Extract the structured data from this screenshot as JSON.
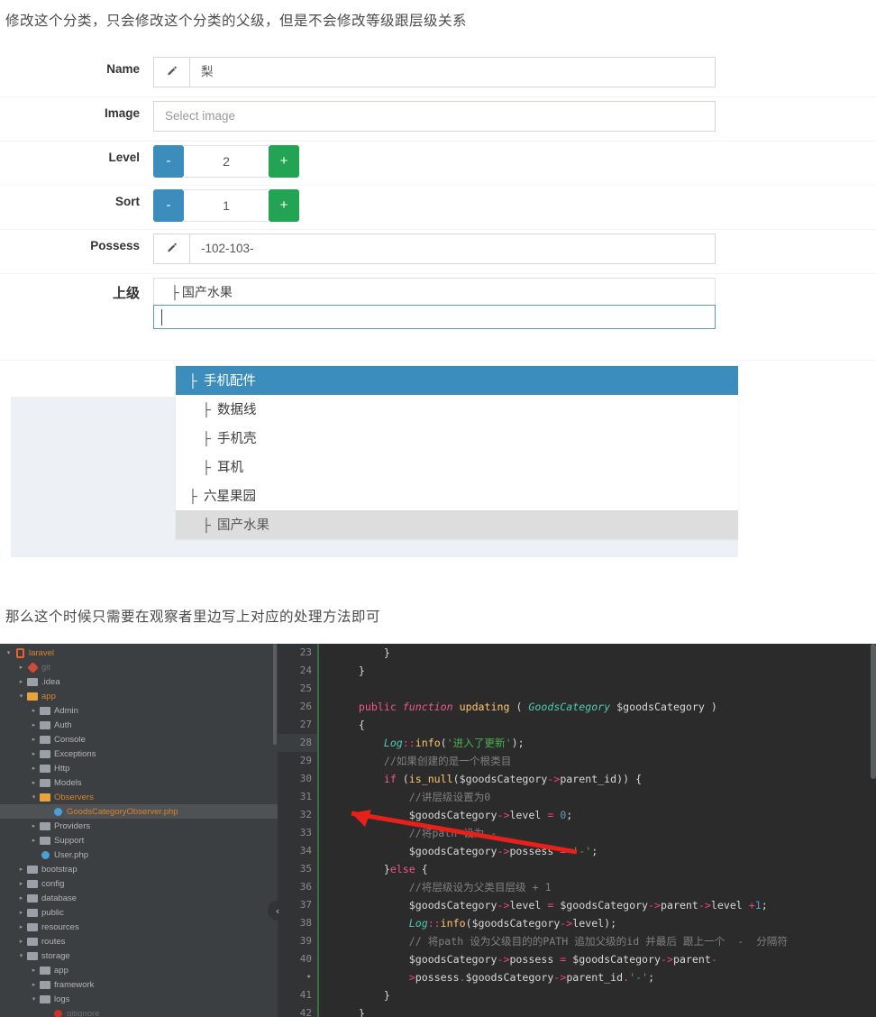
{
  "doc": {
    "paragraph1": "修改这个分类，只会修改这个分类的父级，但是不会修改等级跟层级关系",
    "paragraph2": "那么这个时候只需要在观察者里边写上对应的处理方法即可"
  },
  "form": {
    "rows": [
      {
        "label": "Name",
        "type": "icon-input",
        "icon": "pencil-icon",
        "value": "梨"
      },
      {
        "label": "Image",
        "type": "input",
        "value": "",
        "placeholder": "Select image"
      },
      {
        "label": "Level",
        "type": "stepper",
        "value": "2",
        "minus": "-",
        "plus": "+"
      },
      {
        "label": "Sort",
        "type": "stepper",
        "value": "1",
        "minus": "-",
        "plus": "+"
      },
      {
        "label": "Possess",
        "type": "icon-input",
        "icon": "pencil-icon",
        "value": "-102-103-"
      },
      {
        "label": "上级",
        "type": "select",
        "value": "国产水果"
      }
    ],
    "select_search_value": ""
  },
  "dropdown": {
    "items": [
      {
        "label": "手机配件",
        "level": 1,
        "state": "selected"
      },
      {
        "label": "数据线",
        "level": 2,
        "state": "normal"
      },
      {
        "label": "手机壳",
        "level": 2,
        "state": "normal"
      },
      {
        "label": "耳机",
        "level": 2,
        "state": "normal"
      },
      {
        "label": "六星果园",
        "level": 1,
        "state": "normal"
      },
      {
        "label": "国产水果",
        "level": 2,
        "state": "current"
      }
    ],
    "tree_glyph": "├"
  },
  "colors": {
    "primary_blue": "#3c8dbc",
    "green": "#23a455",
    "current_grey": "#dddddd",
    "panel_bg": "#edf0f5",
    "ide_bg": "#2b2b2b",
    "tree_bg": "#3c3f41"
  },
  "ide": {
    "tree": [
      {
        "name": "laravel",
        "indent": 0,
        "arrow": "open",
        "icon": "project-icon",
        "style": "orange"
      },
      {
        "name": "git",
        "indent": 1,
        "arrow": "closed",
        "icon": "git-icon",
        "style": "dim"
      },
      {
        "name": ".idea",
        "indent": 1,
        "arrow": "closed",
        "icon": "folder-icon",
        "style": "grey"
      },
      {
        "name": "app",
        "indent": 1,
        "arrow": "open",
        "icon": "folder-icon-orange",
        "style": "orange"
      },
      {
        "name": "Admin",
        "indent": 2,
        "arrow": "closed",
        "icon": "folder-icon",
        "style": "grey"
      },
      {
        "name": "Auth",
        "indent": 2,
        "arrow": "closed",
        "icon": "folder-icon",
        "style": "grey"
      },
      {
        "name": "Console",
        "indent": 2,
        "arrow": "closed",
        "icon": "folder-icon",
        "style": "grey"
      },
      {
        "name": "Exceptions",
        "indent": 2,
        "arrow": "closed",
        "icon": "folder-icon",
        "style": "grey"
      },
      {
        "name": "Http",
        "indent": 2,
        "arrow": "closed",
        "icon": "folder-icon",
        "style": "grey"
      },
      {
        "name": "Models",
        "indent": 2,
        "arrow": "closed",
        "icon": "folder-icon",
        "style": "grey"
      },
      {
        "name": "Observers",
        "indent": 2,
        "arrow": "open",
        "icon": "folder-icon-orange",
        "style": "orange"
      },
      {
        "name": "GoodsCategoryObserver.php",
        "indent": 3,
        "arrow": "none",
        "icon": "php-file-icon",
        "style": "orange",
        "selected": true
      },
      {
        "name": "Providers",
        "indent": 2,
        "arrow": "closed",
        "icon": "folder-icon",
        "style": "grey"
      },
      {
        "name": "Support",
        "indent": 2,
        "arrow": "closed",
        "icon": "folder-icon",
        "style": "grey"
      },
      {
        "name": "User.php",
        "indent": 2,
        "arrow": "none",
        "icon": "php-file-icon",
        "style": "grey"
      },
      {
        "name": "bootstrap",
        "indent": 1,
        "arrow": "closed",
        "icon": "folder-icon",
        "style": "grey"
      },
      {
        "name": "config",
        "indent": 1,
        "arrow": "closed",
        "icon": "folder-icon",
        "style": "grey"
      },
      {
        "name": "database",
        "indent": 1,
        "arrow": "closed",
        "icon": "folder-icon",
        "style": "grey"
      },
      {
        "name": "public",
        "indent": 1,
        "arrow": "closed",
        "icon": "folder-icon",
        "style": "grey"
      },
      {
        "name": "resources",
        "indent": 1,
        "arrow": "closed",
        "icon": "folder-icon",
        "style": "grey"
      },
      {
        "name": "routes",
        "indent": 1,
        "arrow": "closed",
        "icon": "folder-icon",
        "style": "grey"
      },
      {
        "name": "storage",
        "indent": 1,
        "arrow": "open",
        "icon": "folder-icon",
        "style": "grey"
      },
      {
        "name": "app",
        "indent": 2,
        "arrow": "closed",
        "icon": "folder-icon",
        "style": "grey"
      },
      {
        "name": "framework",
        "indent": 2,
        "arrow": "closed",
        "icon": "folder-icon",
        "style": "grey"
      },
      {
        "name": "logs",
        "indent": 2,
        "arrow": "open",
        "icon": "folder-icon",
        "style": "grey"
      },
      {
        "name": "gitignore",
        "indent": 3,
        "arrow": "none",
        "icon": "file-icon",
        "style": "dim"
      }
    ],
    "line_numbers": [
      "23",
      "24",
      "25",
      "26",
      "27",
      "28",
      "29",
      "30",
      "31",
      "32",
      "33",
      "34",
      "35",
      "36",
      "37",
      "38",
      "39",
      "40",
      "•",
      "41",
      "42"
    ],
    "highlighted_line": "28",
    "collapse_icon": "‹",
    "code_lines": [
      "        }",
      "    }",
      "",
      "    public function updating ( GoodsCategory $goodsCategory )",
      "    {",
      "        Log::info('进入了更新');",
      "        //如果创建的是一个根类目",
      "        if (is_null($goodsCategory->parent_id)) {",
      "            //讲层级设置为0",
      "            $goodsCategory->level = 0;",
      "            //将path 设为 -",
      "            $goodsCategory->possess = '-';",
      "        }else {",
      "            //将层级设为父类目层级 + 1",
      "            $goodsCategory->level = $goodsCategory->parent->level +1;",
      "            Log::info($goodsCategory->level);",
      "            // 将path 设为父级目的的PATH 追加父级的id 并最后 跟上一个  -  分隔符",
      "            $goodsCategory->possess = $goodsCategory->parent-",
      "            >possess.$goodsCategory->parent_id.'-';",
      "        }",
      "    }"
    ]
  }
}
